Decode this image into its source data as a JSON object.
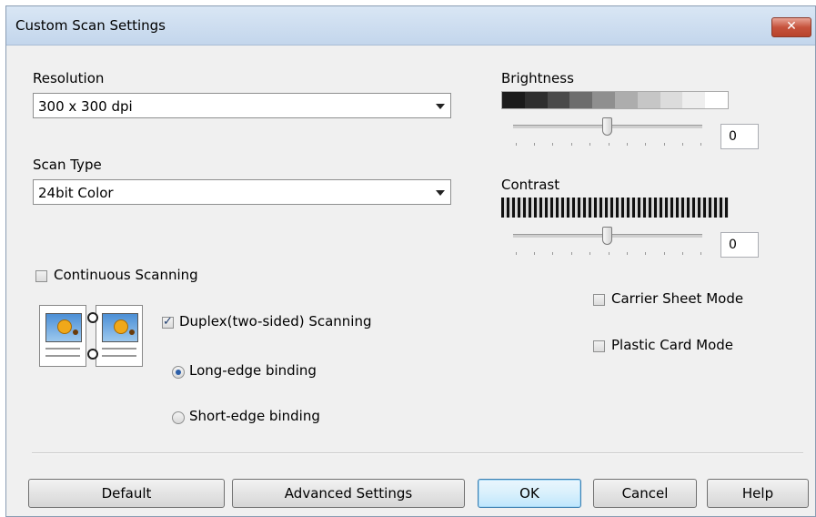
{
  "window": {
    "title": "Custom Scan Settings",
    "close_label": "✕"
  },
  "resolution": {
    "label": "Resolution",
    "value": "300 x 300 dpi"
  },
  "scan_type": {
    "label": "Scan Type",
    "value": "24bit Color"
  },
  "brightness": {
    "label": "Brightness",
    "value": "0",
    "level": 0
  },
  "contrast": {
    "label": "Contrast",
    "value": "0",
    "level": 0
  },
  "options": {
    "continuous": {
      "label": "Continuous Scanning",
      "checked": false
    },
    "duplex": {
      "label": "Duplex(two-sided) Scanning",
      "checked": true
    },
    "long_edge": {
      "label": "Long-edge binding",
      "selected": true
    },
    "short_edge": {
      "label": "Short-edge binding",
      "selected": false
    },
    "carrier": {
      "label": "Carrier Sheet Mode",
      "checked": false
    },
    "plastic": {
      "label": "Plastic Card Mode",
      "checked": false
    }
  },
  "buttons": {
    "default": "Default",
    "advanced": "Advanced Settings",
    "ok": "OK",
    "cancel": "Cancel",
    "help": "Help"
  },
  "icons": {
    "duplex": "duplex-pages-icon",
    "close": "close-icon",
    "dropdown": "chevron-down-icon"
  },
  "colors": {
    "titlebar": "#c9dbef",
    "close": "#c6533d",
    "default_button": "#bee6fd"
  }
}
